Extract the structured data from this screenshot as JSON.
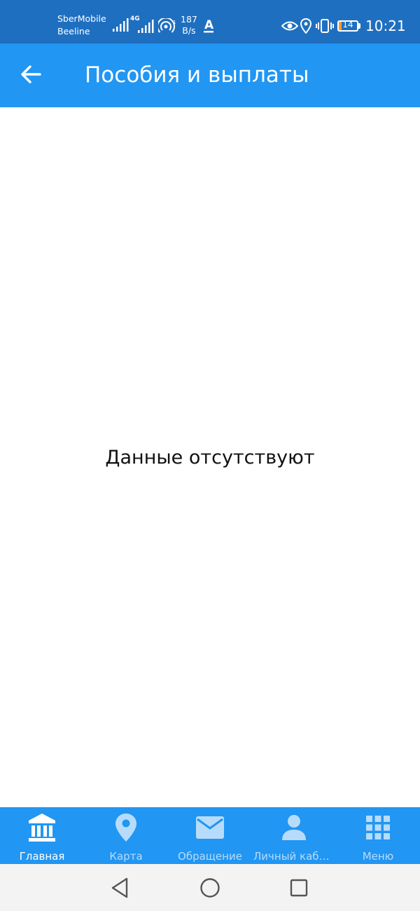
{
  "status_bar": {
    "carrier_1": "SberMobile",
    "carrier_2": "Beeline",
    "network_type": "4G",
    "net_speed_value": "187",
    "net_speed_unit": "B/s",
    "battery_level": "14",
    "battery_fraction": 0.14,
    "time": "10:21",
    "bg_color": "#1f6fc0",
    "icons": [
      "signal-bars-icon",
      "signal-4g-icon",
      "hotspot-icon",
      "font-a-icon",
      "eye-icon",
      "location-icon",
      "vibrate-icon",
      "battery-icon"
    ]
  },
  "app_bar": {
    "title": "Пособия и выплаты",
    "back_icon": "arrow-back-icon",
    "bg_color": "#2196f3"
  },
  "main": {
    "empty_message": "Данные отсутствуют"
  },
  "bottom_nav": {
    "bg_color": "#2196f3",
    "items": [
      {
        "label": "Главная",
        "icon": "bank-building-icon",
        "active": true
      },
      {
        "label": "Карта",
        "icon": "map-pin-icon",
        "active": false
      },
      {
        "label": "Обращение",
        "icon": "envelope-icon",
        "active": false
      },
      {
        "label": "Личный каби...",
        "icon": "person-icon",
        "active": false
      },
      {
        "label": "Меню",
        "icon": "grid-menu-icon",
        "active": false
      }
    ]
  },
  "system_nav": {
    "icons": [
      "back-triangle-icon",
      "home-circle-icon",
      "recents-square-icon"
    ]
  }
}
